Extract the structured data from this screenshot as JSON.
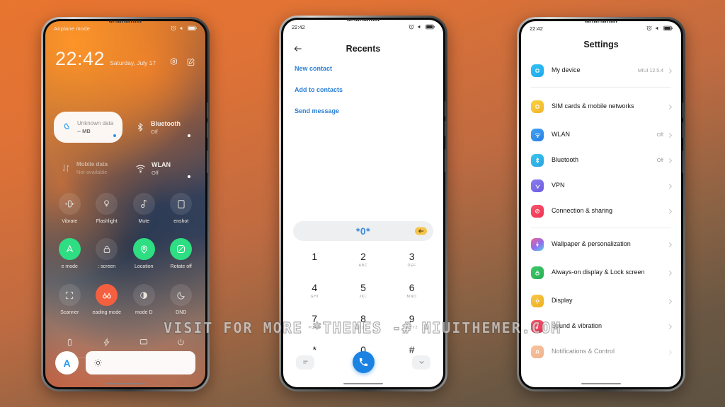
{
  "background": {
    "gradient_start": "#e8752f",
    "gradient_end": "#5e5241"
  },
  "watermark": {
    "text": "VISIT FOR MORE *THEMES -# MIUITHEMER.COM"
  },
  "phone1": {
    "statusbar": {
      "left_text": "Airplane mode",
      "time": "",
      "icons": [
        "alarm-icon",
        "mute-icon",
        "battery-icon"
      ]
    },
    "lockscreen": {
      "clock": "22:42",
      "date": "Saturday, July 17",
      "action_icons": [
        "settings-gear-icon",
        "edit-icon"
      ]
    },
    "quick_big": [
      {
        "title": "Unknown data",
        "subtitle": "-- MB",
        "state": "on",
        "icon": "water-drop-icon"
      },
      {
        "title": "Bluetooth",
        "subtitle": "Off",
        "state": "off",
        "icon": "bluetooth-icon"
      },
      {
        "title": "Mobile data",
        "subtitle": "Not available",
        "state": "off",
        "icon": "mobile-data-icon"
      },
      {
        "title": "WLAN",
        "subtitle": "Off",
        "state": "off",
        "icon": "wifi-icon"
      }
    ],
    "toggles_row1": [
      {
        "label": "Vibrate",
        "icon": "vibrate-icon",
        "active": false
      },
      {
        "label": "Flashlight",
        "icon": "flashlight-icon",
        "active": false
      },
      {
        "label": "Mute",
        "icon": "music-note-icon",
        "active": false
      },
      {
        "label": "enshot",
        "icon": "screenshot-icon",
        "active": false
      }
    ],
    "toggles_row2": [
      {
        "label": "e mode",
        "icon": "airplane-icon",
        "active": true
      },
      {
        "label": ": screen",
        "icon": "lock-icon",
        "active": false
      },
      {
        "label": "Location",
        "icon": "location-pin-icon",
        "active": true
      },
      {
        "label": "Rotate off",
        "icon": "rotate-lock-icon",
        "active": true
      }
    ],
    "toggles_row3": [
      {
        "label": "Scanner",
        "icon": "scanner-icon",
        "active": false
      },
      {
        "label": "eading mode",
        "icon": "reading-mode-icon",
        "active": true
      },
      {
        "label": "mode    D",
        "icon": "dark-mode-icon",
        "active": false
      },
      {
        "label": "DND",
        "icon": "dnd-moon-icon",
        "active": false
      }
    ],
    "toggles_row4": [
      {
        "icon": "battery-saver-icon"
      },
      {
        "icon": "lightning-icon"
      },
      {
        "icon": "cast-icon"
      },
      {
        "icon": "power-icon"
      }
    ],
    "brightness": {
      "auto_label": "A",
      "icon": "brightness-sun-icon"
    }
  },
  "phone2": {
    "statusbar": {
      "time": "22:42",
      "icons": [
        "alarm-icon",
        "mute-icon",
        "battery-icon"
      ]
    },
    "title": "Recents",
    "back_icon": "back-arrow-icon",
    "links": [
      "New contact",
      "Add to contacts",
      "Send message"
    ],
    "dialpad": {
      "number": "*0*",
      "backspace_icon": "backspace-icon",
      "keys": [
        {
          "digit": "1",
          "letters": ""
        },
        {
          "digit": "2",
          "letters": "ABC"
        },
        {
          "digit": "3",
          "letters": "DEF"
        },
        {
          "digit": "4",
          "letters": "GHI"
        },
        {
          "digit": "5",
          "letters": "JKL"
        },
        {
          "digit": "6",
          "letters": "MNO"
        },
        {
          "digit": "7",
          "letters": "PQRS"
        },
        {
          "digit": "8",
          "letters": "TUV"
        },
        {
          "digit": "9",
          "letters": "WXYZ"
        },
        {
          "digit": "*",
          "letters": ""
        },
        {
          "digit": "0",
          "letters": "+"
        },
        {
          "digit": "#",
          "letters": ""
        }
      ],
      "left_icon": "menu-icon",
      "call_icon": "phone-call-icon",
      "right_icon": "chevron-down-icon",
      "call_color": "#1b82e3"
    }
  },
  "phone3": {
    "statusbar": {
      "time": "22:42",
      "icons": [
        "alarm-icon",
        "mute-icon",
        "battery-icon"
      ]
    },
    "title": "Settings",
    "groups": [
      {
        "rows": [
          {
            "label": "My device",
            "value": "MIUI 12.5.4",
            "icon": "device-icon",
            "color": "#2bb7f0"
          }
        ]
      },
      {
        "rows": [
          {
            "label": "SIM cards & mobile networks",
            "value": "",
            "icon": "sim-card-icon",
            "color": "#f5c game"
          }
        ]
      }
    ],
    "items": [
      {
        "label": "My device",
        "value": "MIUI 12.5.4",
        "icon": "device-icon",
        "color1": "#31c3f5",
        "color2": "#1ea8ea",
        "tall": false,
        "sep_after": true
      },
      {
        "label": "SIM cards & mobile networks",
        "value": "",
        "icon": "sim-card-icon",
        "color1": "#f8d33f",
        "color2": "#f2b42c",
        "tall": true,
        "sep_after": false
      },
      {
        "label": "WLAN",
        "value": "Off",
        "icon": "wifi-icon",
        "color1": "#3fa3f5",
        "color2": "#2a7fe0",
        "tall": false,
        "sep_after": false
      },
      {
        "label": "Bluetooth",
        "value": "Off",
        "icon": "bluetooth-icon",
        "color1": "#38c6f0",
        "color2": "#2aa3e0",
        "tall": false,
        "sep_after": false
      },
      {
        "label": "VPN",
        "value": "",
        "icon": "vpn-icon",
        "color1": "#8b7df0",
        "color2": "#6b5ce0",
        "tall": false,
        "sep_after": false
      },
      {
        "label": "Connection & sharing",
        "value": "",
        "icon": "connection-sharing-icon",
        "color1": "#f7556f",
        "color2": "#ef3350",
        "tall": false,
        "sep_after": true
      },
      {
        "label": "Wallpaper & personalization",
        "value": "",
        "icon": "wallpaper-icon",
        "color1": "#f06292",
        "color2": "#7e57f0",
        "tall": false,
        "sep_after": false
      },
      {
        "label": "Always-on display & Lock screen",
        "value": "",
        "icon": "lock-screen-icon",
        "color1": "#3ec96a",
        "color2": "#27ae52",
        "tall": true,
        "sep_after": false
      },
      {
        "label": "Display",
        "value": "",
        "icon": "display-icon",
        "color1": "#f7c948",
        "color2": "#eeae22",
        "tall": false,
        "sep_after": false
      },
      {
        "label": "Sound & vibration",
        "value": "",
        "icon": "sound-icon",
        "color1": "#f95a6e",
        "color2": "#ee3050",
        "tall": false,
        "sep_after": false
      },
      {
        "label": "Notifications & Control",
        "value": "",
        "icon": "notifications-icon",
        "color1": "#f08a3c",
        "color2": "#e06a20",
        "tall": false,
        "sep_after": false
      }
    ]
  }
}
